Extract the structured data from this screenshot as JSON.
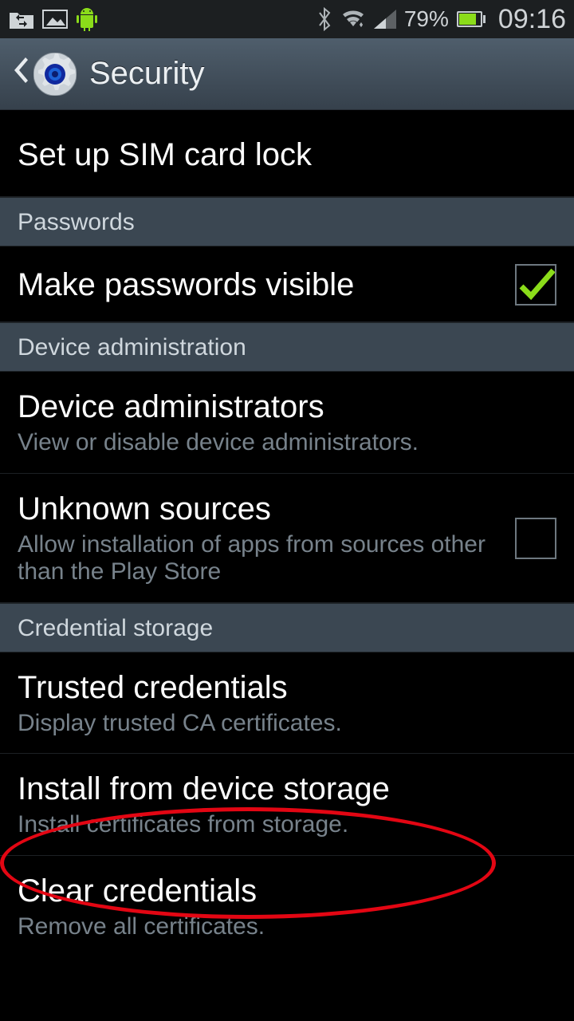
{
  "status": {
    "battery_pct": "79%",
    "time": "09:16"
  },
  "header": {
    "title": "Security"
  },
  "items": {
    "sim": {
      "label": "Set up SIM card lock"
    },
    "section_passwords": "Passwords",
    "pw_visible": {
      "label": "Make passwords visible",
      "checked": true
    },
    "section_device_admin": "Device administration",
    "device_admins": {
      "label": "Device administrators",
      "desc": "View or disable device administrators."
    },
    "unknown_sources": {
      "label": "Unknown sources",
      "desc": "Allow installation of apps from sources other than the Play Store",
      "checked": false
    },
    "section_cred": "Credential storage",
    "trusted": {
      "label": "Trusted credentials",
      "desc": "Display trusted CA certificates."
    },
    "install": {
      "label": "Install from device storage",
      "desc": "Install certificates from storage."
    },
    "clear": {
      "label": "Clear credentials",
      "desc": "Remove all certificates."
    }
  }
}
